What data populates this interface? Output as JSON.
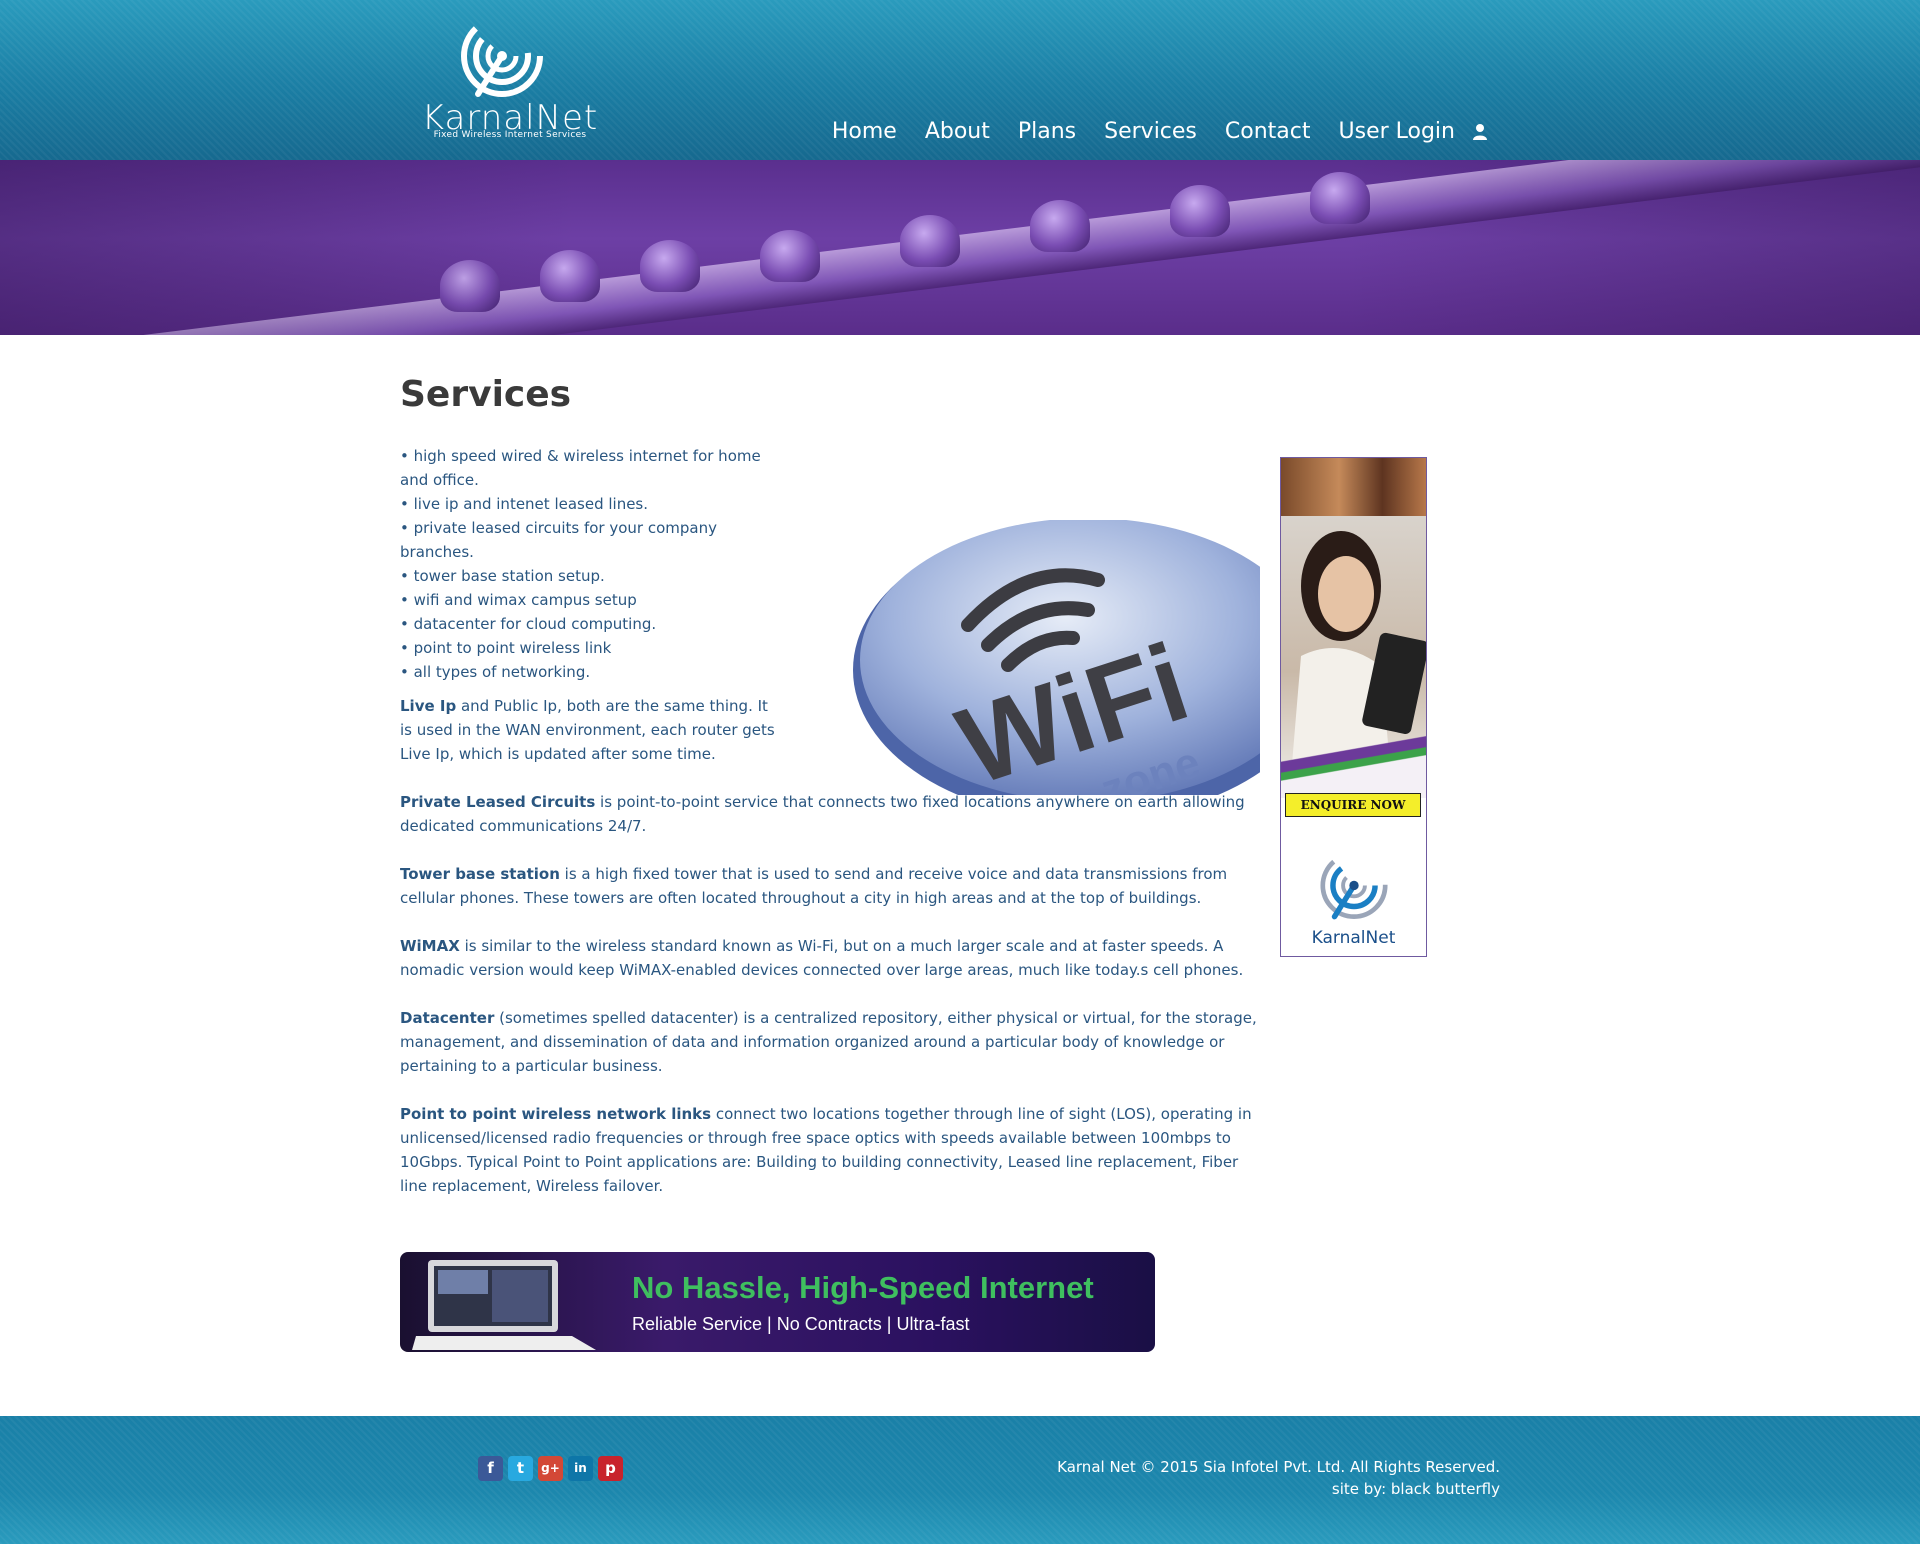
{
  "header": {
    "logo_text": "KarnalNet",
    "logo_tagline": "Fixed Wireless Internet Services",
    "nav": [
      "Home",
      "About",
      "Plans",
      "Services",
      "Contact",
      "User Login"
    ]
  },
  "main": {
    "title": "Services",
    "bullets": [
      "• high speed wired & wireless internet for home and office.",
      "• live ip and intenet leased lines.",
      "• private leased circuits for your company branches.",
      "• tower base station setup.",
      "• wifi and wimax campus setup",
      "• datacenter for cloud computing.",
      "• point to point wireless link",
      "• all types of networking."
    ],
    "sections": [
      {
        "term": "Live Ip",
        "text": " and Public Ip, both are the same thing. It is used in the WAN environment, each router gets Live Ip, which is updated after some time."
      },
      {
        "term": "Private Leased Circuits",
        "text": " is point-to-point service that connects two fixed locations anywhere on earth allowing dedicated communications 24/7."
      },
      {
        "term": "Tower base station",
        "text": " is a high fixed tower that is used to send and receive voice and data transmissions from cellular phones. These towers are often located throughout a city in high areas and at the top of buildings."
      },
      {
        "term": "WiMAX",
        "text": " is similar to the wireless standard known as Wi-Fi, but on a much larger scale and at faster speeds. A nomadic version would keep WiMAX-enabled devices connected over large areas, much like today.s cell phones."
      },
      {
        "term": "Datacenter",
        "text": " (sometimes spelled datacenter) is a centralized repository, either physical or virtual, for the storage, management, and dissemination of data and information organized around a particular body of knowledge or pertaining to a particular business."
      },
      {
        "term": "Point to point wireless network links",
        "text": " connect two locations together through line of sight (LOS), operating in unlicensed/licensed radio frequencies or through free space optics with speeds available between 100mbps to 10Gbps. Typical Point to Point applications are: Building to building connectivity, Leased line replacement, Fiber line replacement, Wireless failover."
      }
    ],
    "wifi_image": {
      "line1": "WiFi",
      "line2": "zone"
    }
  },
  "side_ad": {
    "button": "ENQUIRE NOW",
    "logo_text": "KarnalNet"
  },
  "promo": {
    "headline": "No Hassle, High-Speed Internet",
    "subline": "Reliable Service  |  No Contracts  |  Ultra-fast"
  },
  "footer": {
    "social": [
      "f",
      "t",
      "g+",
      "in",
      "p"
    ],
    "copyright": "Karnal Net © 2015 Sia Infotel Pvt. Ltd. All Rights Reserved.",
    "credit": "site by: black butterfly"
  },
  "colors": {
    "header_teal": "#1b7ea4",
    "banner_purple": "#5a2f8e",
    "body_text": "#2a5680",
    "title": "#3a3a3a",
    "promo_green": "#3fbf5f"
  }
}
